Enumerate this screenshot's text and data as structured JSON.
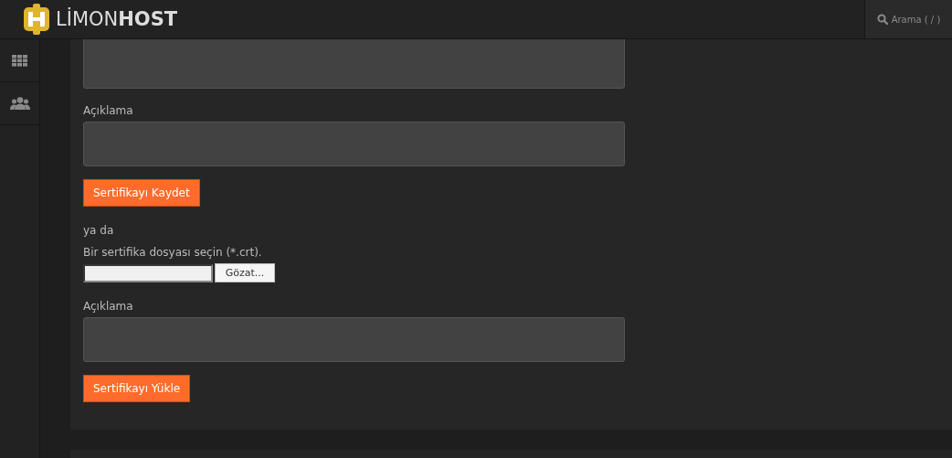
{
  "header": {
    "logo": {
      "light": "LİMON",
      "bold": "HOST"
    },
    "search": {
      "label": "Arama ( / )"
    }
  },
  "sidebar": {
    "items": [
      {
        "kind": "grid"
      },
      {
        "kind": "users"
      }
    ]
  },
  "form": [
    {
      "kind": "textarea"
    },
    {
      "kind": "label",
      "text": "Açıklama"
    },
    {
      "kind": "textarea"
    },
    {
      "kind": "button",
      "text": "Sertifikayı Kaydet"
    },
    {
      "kind": "text",
      "text": "ya da"
    },
    {
      "kind": "label",
      "text": "Bir sertifika dosyası seçin (*.crt)."
    },
    {
      "kind": "file",
      "button": "Gözat..."
    },
    {
      "kind": "label",
      "text": "Açıklama"
    },
    {
      "kind": "textarea"
    },
    {
      "kind": "button",
      "text": "Sertifikayı Yükle"
    }
  ]
}
